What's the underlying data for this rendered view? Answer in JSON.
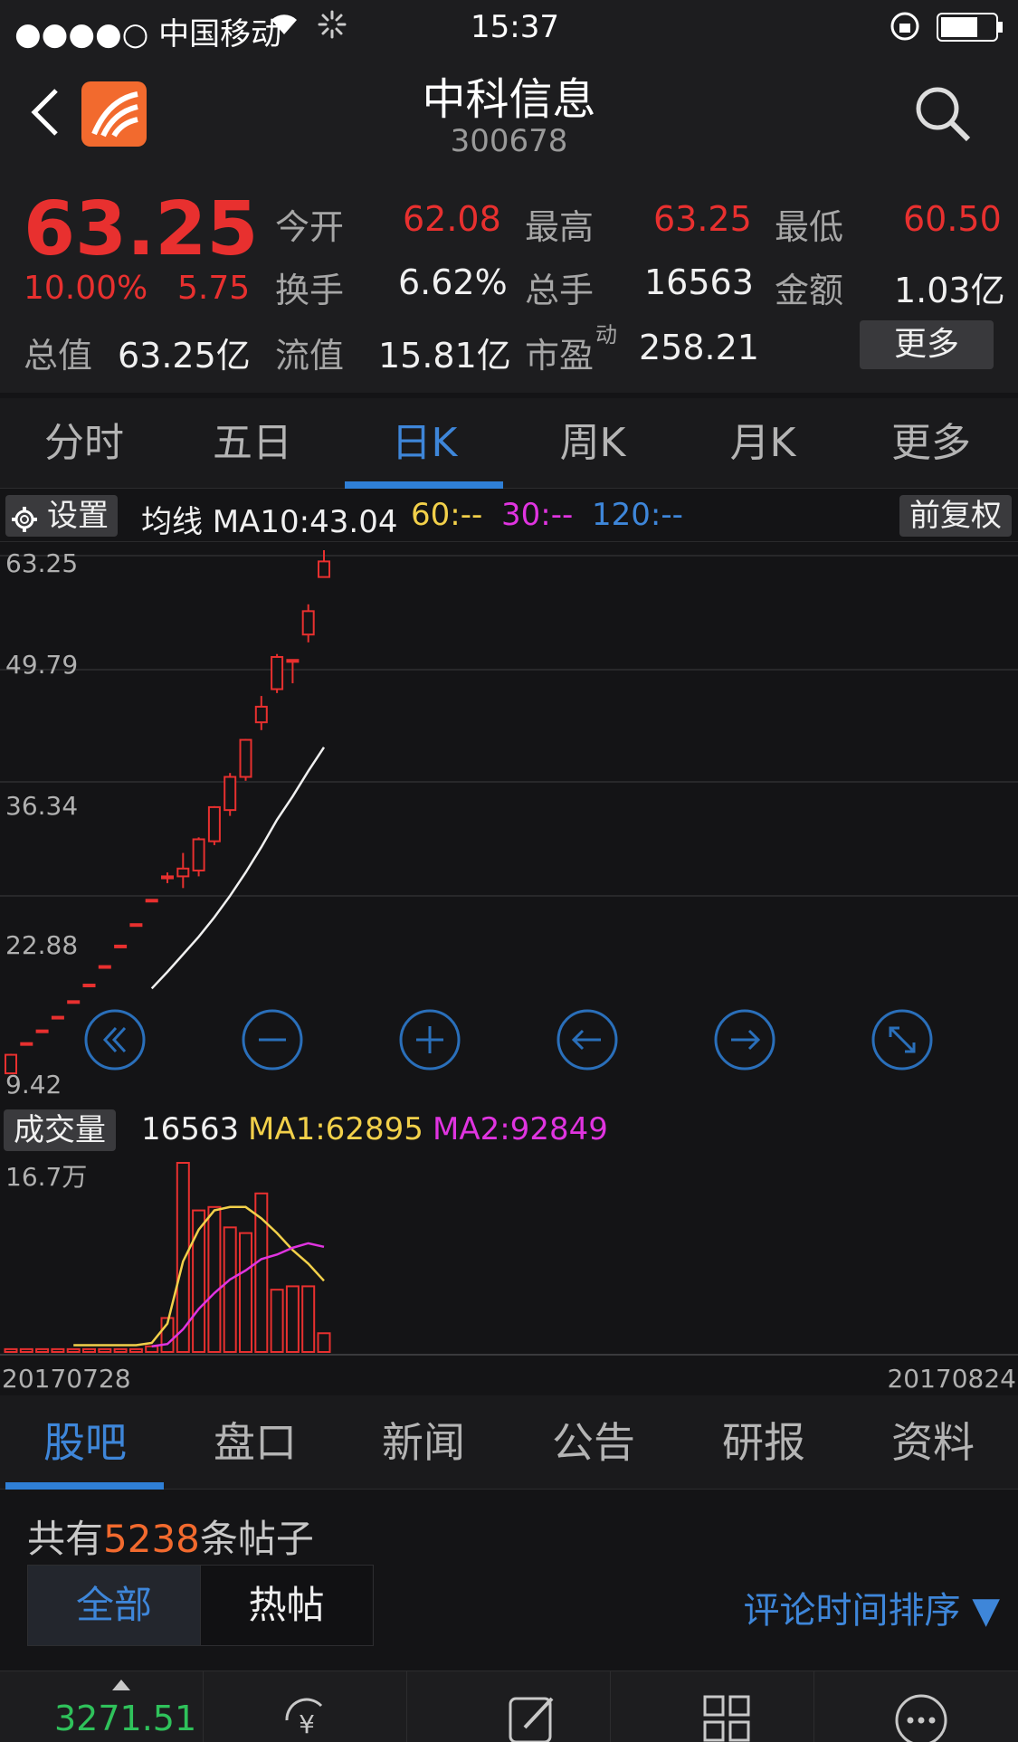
{
  "status_bar": {
    "carrier": "●●●●○ 中国移动",
    "time": "15:37"
  },
  "header": {
    "name": "中科信息",
    "code": "300678"
  },
  "quote": {
    "price": "63.25",
    "change_pct": "10.00%",
    "change": "5.75",
    "open_label": "今开",
    "open": "62.08",
    "high_label": "最高",
    "high": "63.25",
    "low_label": "最低",
    "low": "60.50",
    "turnover_label": "换手",
    "turnover": "6.62%",
    "volume_label": "总手",
    "volume": "16563",
    "amount_label": "金额",
    "amount": "1.03亿",
    "mktcap_label": "总值",
    "mktcap": "63.25亿",
    "float_label": "流值",
    "float": "15.81亿",
    "pe_label": "市盈",
    "pe_sup": "动",
    "pe": "258.21",
    "more": "更多"
  },
  "chart_tabs": [
    "分时",
    "五日",
    "日K",
    "周K",
    "月K",
    "更多"
  ],
  "ma_bar": {
    "settings": "设置",
    "ma_label": "均线 MA10:43.04",
    "ma60": "60:--",
    "ma30": "30:--",
    "ma120": "120:--",
    "adjust": "前复权"
  },
  "kchart_labels": [
    "63.25",
    "49.79",
    "36.34",
    "22.88",
    "9.42"
  ],
  "vol_bar": {
    "title": "成交量",
    "vol": "16563",
    "ma1": "MA1:62895",
    "ma2": "MA2:92849",
    "max_label": "16.7万",
    "start_date": "20170728",
    "end_date": "20170824"
  },
  "chart_data": {
    "type": "candlestick",
    "price_range": [
      9.42,
      63.25
    ],
    "candles": [
      {
        "o": 9.6,
        "c": 11.5,
        "h": 11.6,
        "l": 9.5
      },
      {
        "o": 12.6,
        "c": 12.7,
        "h": 12.7,
        "l": 12.6
      },
      {
        "o": 13.9,
        "c": 14.0,
        "h": 14.0,
        "l": 13.9
      },
      {
        "o": 15.3,
        "c": 15.4,
        "h": 15.4,
        "l": 15.3
      },
      {
        "o": 16.9,
        "c": 17.0,
        "h": 17.0,
        "l": 16.9
      },
      {
        "o": 18.6,
        "c": 18.7,
        "h": 18.7,
        "l": 18.6
      },
      {
        "o": 20.5,
        "c": 20.6,
        "h": 20.6,
        "l": 20.5
      },
      {
        "o": 22.6,
        "c": 22.7,
        "h": 22.7,
        "l": 22.6
      },
      {
        "o": 24.8,
        "c": 24.9,
        "h": 24.9,
        "l": 24.8
      },
      {
        "o": 27.3,
        "c": 27.4,
        "h": 27.4,
        "l": 27.3
      },
      {
        "o": 29.6,
        "c": 29.8,
        "h": 30.2,
        "l": 29.1
      },
      {
        "o": 29.8,
        "c": 30.6,
        "h": 32.2,
        "l": 28.6
      },
      {
        "o": 30.4,
        "c": 33.6,
        "h": 33.8,
        "l": 29.8
      },
      {
        "o": 33.4,
        "c": 36.9,
        "h": 37.0,
        "l": 33.0
      },
      {
        "o": 36.6,
        "c": 40.0,
        "h": 40.4,
        "l": 36.0
      },
      {
        "o": 40.0,
        "c": 43.8,
        "h": 43.9,
        "l": 39.6
      },
      {
        "o": 45.6,
        "c": 47.2,
        "h": 48.3,
        "l": 44.8
      },
      {
        "o": 49.0,
        "c": 52.3,
        "h": 52.6,
        "l": 48.6
      },
      {
        "o": 51.8,
        "c": 52.0,
        "h": 52.0,
        "l": 49.6
      },
      {
        "o": 54.6,
        "c": 57.0,
        "h": 57.7,
        "l": 53.8
      },
      {
        "o": 60.5,
        "c": 62.1,
        "h": 63.25,
        "l": 60.5
      }
    ],
    "ma10": [
      null,
      null,
      null,
      null,
      null,
      null,
      null,
      null,
      null,
      18.3,
      20.0,
      21.8,
      23.6,
      25.6,
      27.8,
      30.2,
      32.8,
      35.6,
      38.0,
      40.6,
      43.04
    ],
    "volume_max": 167000,
    "volumes": [
      2500,
      2500,
      2500,
      2500,
      2500,
      2500,
      2500,
      2500,
      2500,
      5000,
      30000,
      167000,
      125000,
      128000,
      110000,
      105000,
      140000,
      55000,
      58000,
      58000,
      16563
    ],
    "vol_ma1": [
      null,
      null,
      null,
      null,
      6000,
      6000,
      6000,
      6000,
      6000,
      8000,
      25000,
      80000,
      108000,
      125000,
      128000,
      128000,
      118000,
      105000,
      90000,
      78000,
      62895
    ],
    "vol_ma2": [
      null,
      null,
      null,
      null,
      null,
      null,
      null,
      null,
      null,
      5000,
      7000,
      20000,
      38000,
      52000,
      64000,
      72000,
      82000,
      86000,
      92000,
      96000,
      92849
    ]
  },
  "bottom_tabs": [
    "股吧",
    "盘口",
    "新闻",
    "公告",
    "研报",
    "资料"
  ],
  "posts": {
    "prefix": "共有",
    "count": "5238",
    "suffix": "条帖子",
    "tab_all": "全部",
    "tab_hot": "热帖",
    "sort": "评论时间排序 ▼"
  },
  "bottom_nav": {
    "index_value": "3271.51"
  }
}
